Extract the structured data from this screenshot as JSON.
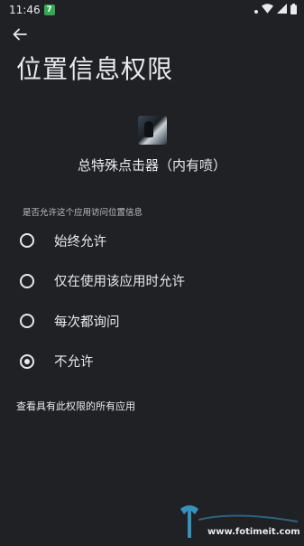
{
  "status_bar": {
    "time": "11:46",
    "app_badge_glyph": "7"
  },
  "header": {
    "back_icon": "arrow-back-icon",
    "title": "位置信息权限"
  },
  "app": {
    "name": "总特殊点击器（内有喷）"
  },
  "permission": {
    "section_label": "是否允许这个应用访问位置信息",
    "options": [
      {
        "label": "始终允许",
        "selected": false
      },
      {
        "label": "仅在使用该应用时允许",
        "selected": false
      },
      {
        "label": "每次都询问",
        "selected": false
      },
      {
        "label": "不允许",
        "selected": true
      }
    ]
  },
  "footer": {
    "link_label": "查看具有此权限的所有应用"
  },
  "watermark": {
    "url": "www.fotimeit.com"
  }
}
